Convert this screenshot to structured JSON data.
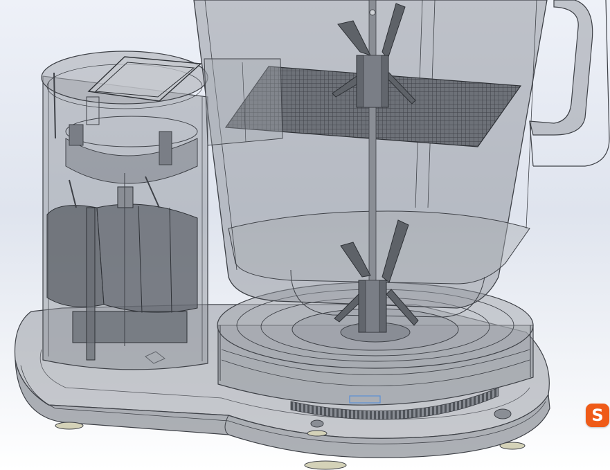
{
  "viewport": {
    "background_top": "#eef1f8",
    "background_bottom": "#ffffff",
    "model_fill": "#7c8088",
    "model_edge": "#3e4147"
  },
  "overlay": {
    "badge_icon": "sogou-ime-icon",
    "badge_letter": "S",
    "badge_color": "#ef5b18"
  }
}
